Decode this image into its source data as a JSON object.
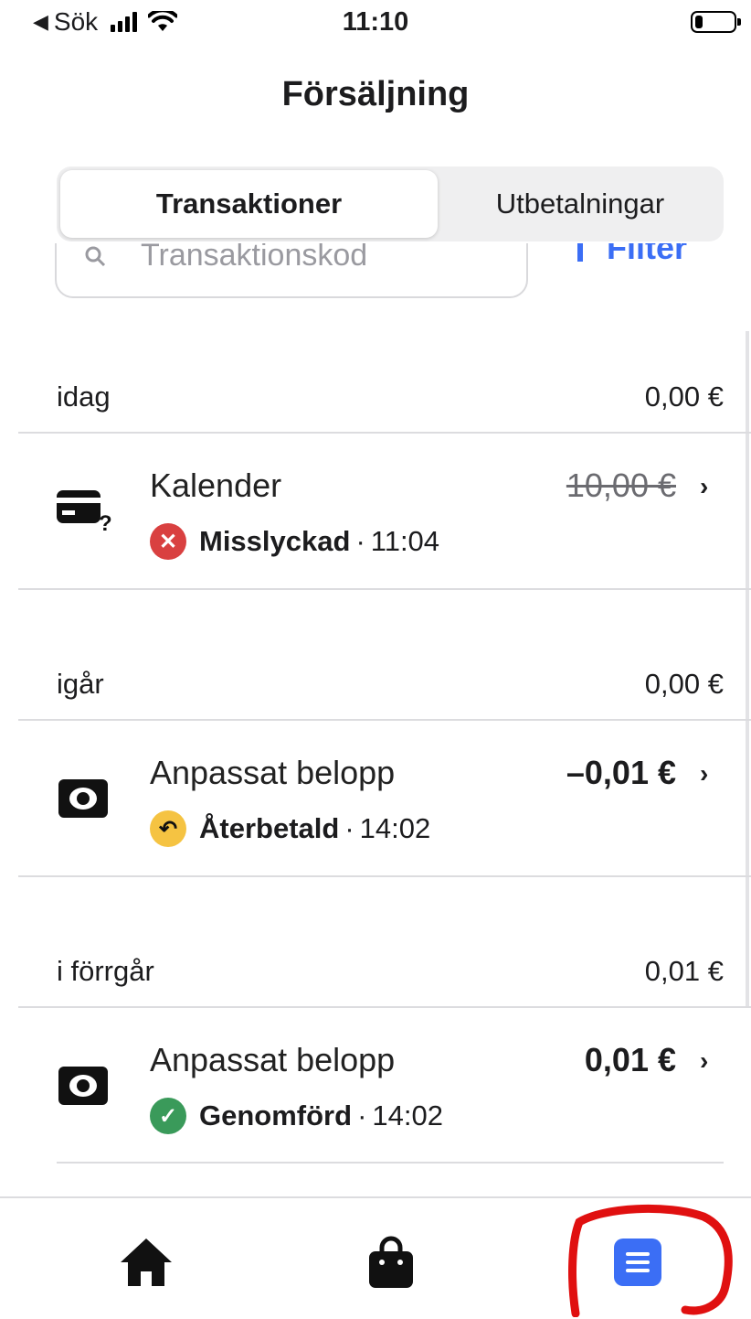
{
  "status_bar": {
    "back_label": "Sök",
    "time": "11:10",
    "battery_level": 0.2
  },
  "header": {
    "title": "Försäljning"
  },
  "segments": {
    "active": "Transaktioner",
    "inactive": "Utbetalningar"
  },
  "search": {
    "placeholder": "Transaktionskod",
    "filter_label": "Filter"
  },
  "sections": [
    {
      "label": "idag",
      "total": "0,00 €",
      "item": {
        "icon": "card-unknown-icon",
        "title": "Kalender",
        "amount": "10,00 €",
        "status": "Misslyckad",
        "status_color": "#d94040",
        "time": "11:04"
      }
    },
    {
      "label": "igår",
      "total": "0,00 €",
      "item": {
        "icon": "cash-icon",
        "title": "Anpassat belopp",
        "amount": "–0,01 €",
        "status": "Återbetald",
        "status_color": "#f5c342",
        "time": "14:02"
      }
    },
    {
      "label": "i förrgår",
      "total": "0,01 €",
      "item": {
        "icon": "cash-icon",
        "title": "Anpassat belopp",
        "amount": "0,01 €",
        "status": "Genomförd",
        "status_color": "#3a9a5a",
        "time": "14:02"
      }
    }
  ],
  "separator": "·",
  "chevron": "›",
  "tabbar": {
    "tabs": [
      "home-icon",
      "shopping-bag-icon",
      "list-icon"
    ],
    "active": "list-icon",
    "accent": "#3b6ef5"
  },
  "annotation": {
    "color": "#e01010"
  }
}
